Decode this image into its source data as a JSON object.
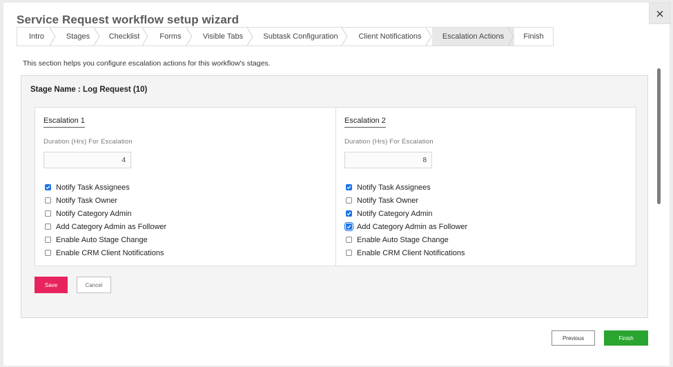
{
  "wizard": {
    "title": "Service Request workflow setup wizard",
    "close_icon": "close-icon",
    "steps": [
      {
        "label": "Intro",
        "active": false
      },
      {
        "label": "Stages",
        "active": false
      },
      {
        "label": "Checklist",
        "active": false
      },
      {
        "label": "Forms",
        "active": false
      },
      {
        "label": "Visible Tabs",
        "active": false
      },
      {
        "label": "Subtask Configuration",
        "active": false
      },
      {
        "label": "Client Notifications",
        "active": false
      },
      {
        "label": "Escalation Actions",
        "active": true
      },
      {
        "label": "Finish",
        "active": false
      }
    ],
    "description": "This section helps you configure escalation actions for this workflow's stages."
  },
  "stage": {
    "name": "Stage Name : Log Request (10)",
    "escalations": [
      {
        "heading": "Escalation 1",
        "duration_label": "Duration (Hrs) For Escalation",
        "duration_value": "4",
        "options": [
          {
            "label": "Notify Task Assignees",
            "checked": true
          },
          {
            "label": "Notify Task Owner",
            "checked": false
          },
          {
            "label": "Notify Category Admin",
            "checked": false
          },
          {
            "label": "Add Category Admin as Follower",
            "checked": false
          },
          {
            "label": "Enable Auto Stage Change",
            "checked": false
          },
          {
            "label": "Enable CRM Client Notifications",
            "checked": false
          }
        ]
      },
      {
        "heading": "Escalation 2",
        "duration_label": "Duration (Hrs) For Escalation",
        "duration_value": "8",
        "options": [
          {
            "label": "Notify Task Assignees",
            "checked": true
          },
          {
            "label": "Notify Task Owner",
            "checked": false
          },
          {
            "label": "Notify Category Admin",
            "checked": true
          },
          {
            "label": "Add Category Admin as Follower",
            "checked": true,
            "focused": true
          },
          {
            "label": "Enable Auto Stage Change",
            "checked": false
          },
          {
            "label": "Enable CRM Client Notifications",
            "checked": false
          }
        ]
      }
    ],
    "save_label": "Save",
    "cancel_label": "Cancel"
  },
  "footer": {
    "previous_label": "Previous",
    "finish_label": "Finish"
  },
  "colors": {
    "save": "#e8245e",
    "finish": "#2aa52f",
    "checkbox": "#1a73e8",
    "active_step": "#e8e8e8"
  }
}
